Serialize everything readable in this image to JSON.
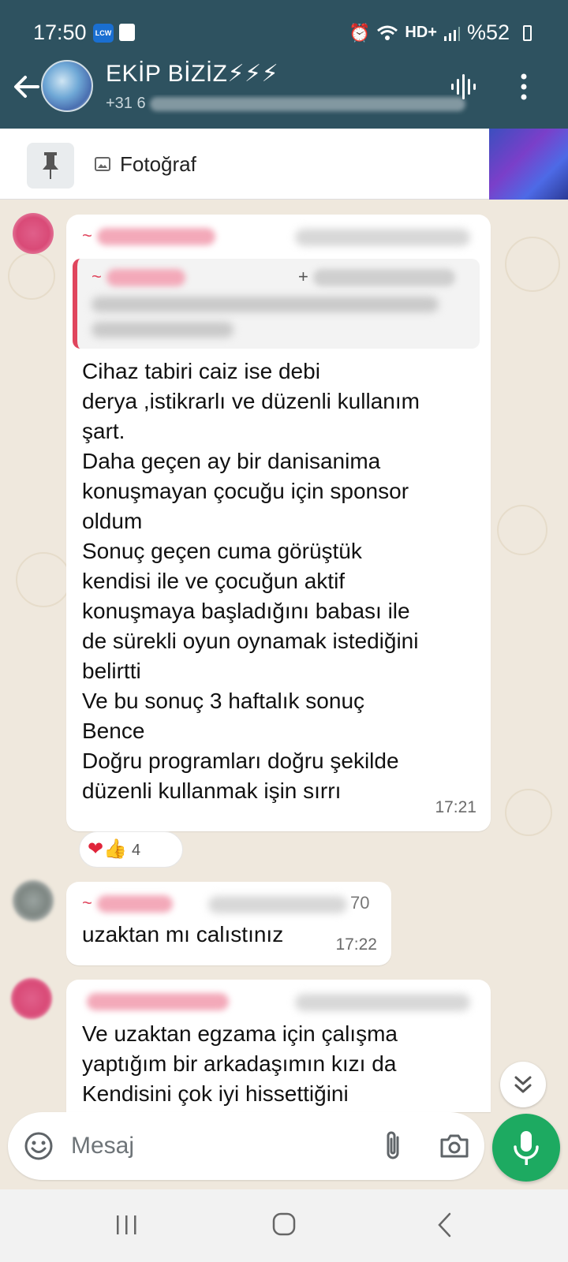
{
  "status_bar": {
    "time": "17:50",
    "app_badge": "LCW",
    "battery": "%52",
    "network": "HD+"
  },
  "header": {
    "title": "EKİP BİZİZ⚡⚡⚡",
    "subtitle_visible": "+31 6"
  },
  "pinned": {
    "label": "Fotoğraf"
  },
  "messages": [
    {
      "sender_prefix": "~",
      "quote_prefix": "~",
      "quote_phone_prefix": "+",
      "text": "Cihaz tabiri caiz ise debi\nderya ,istikrarlı ve düzenli kullanım\nşart.\nDaha geçen ay bir danisanima\nkonuşmayan çocuğu için sponsor\noldum\nSonuç geçen cuma görüştük\nkendisi ile ve çocuğun aktif\nkonuşmaya başladığını babası ile\nde sürekli oyun oynamak istediğini\nbelirtti\nVe bu sonuç 3 haftalık sonuç\nBence\nDoğru programları doğru şekilde\ndüzenli kullanmak işin sırrı",
      "time": "17:21",
      "reaction_count": "4"
    },
    {
      "sender_prefix": "~",
      "phone_suffix": "70",
      "text": "uzaktan mı calıstınız",
      "time": "17:22"
    },
    {
      "text": "Ve uzaktan egzama için çalışma\nyaptığım bir arkadaşımın kızı da\nKendisini çok iyi hissettiğini"
    }
  ],
  "input": {
    "placeholder": "Mesaj"
  },
  "colors": {
    "header_bg": "#2e5260",
    "accent_green": "#1daa61",
    "sender_name": "#e0455d",
    "chat_bg": "#efe8dd"
  }
}
